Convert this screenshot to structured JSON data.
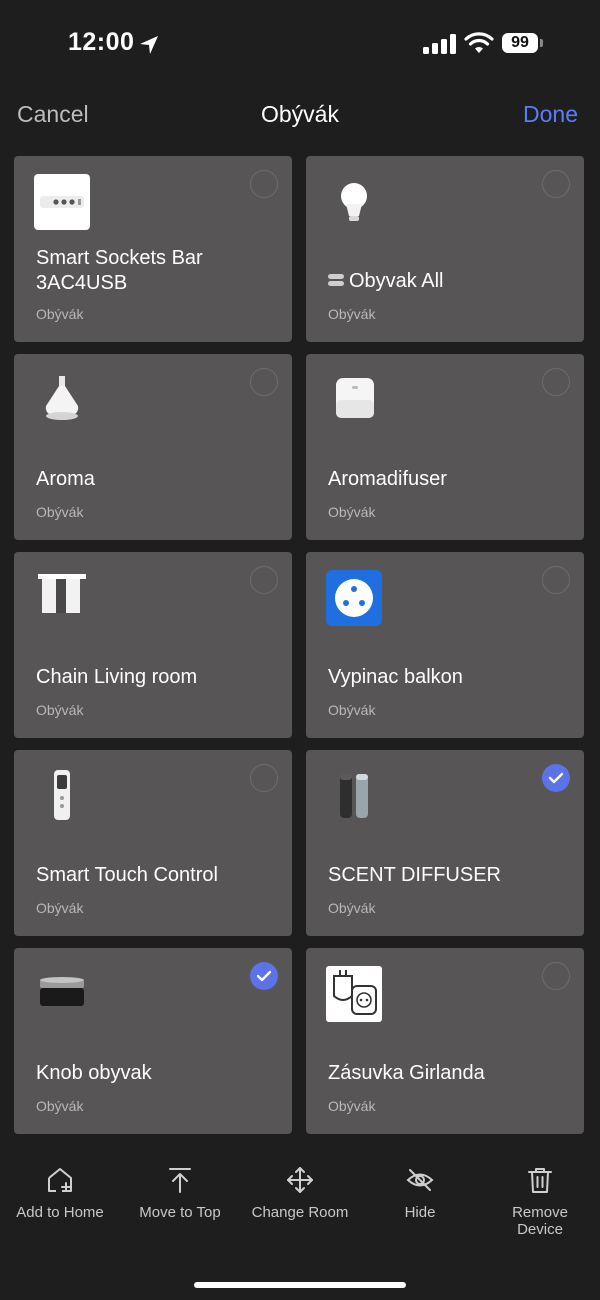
{
  "status_bar": {
    "time": "12:00",
    "battery": "99"
  },
  "nav": {
    "cancel_label": "Cancel",
    "title": "Obývák",
    "done_label": "Done"
  },
  "devices": [
    {
      "name": "Smart Sockets Bar 3AC4USB",
      "room": "Obývák",
      "icon": "power-strip-icon",
      "selected": false
    },
    {
      "name": "Obyvak All",
      "room": "Obývák",
      "icon": "light-bulb-icon",
      "selected": false
    },
    {
      "name": "Aroma",
      "room": "Obývák",
      "icon": "aroma-diffuser-icon",
      "selected": false
    },
    {
      "name": "Aromadifuser",
      "room": "Obývák",
      "icon": "diffuser-box-icon",
      "selected": false
    },
    {
      "name": "Chain Living room",
      "room": "Obývák",
      "icon": "curtain-icon",
      "selected": false
    },
    {
      "name": "Vypinac balkon",
      "room": "Obývák",
      "icon": "socket-icon",
      "selected": false
    },
    {
      "name": "Smart Touch Control",
      "room": "Obývák",
      "icon": "remote-control-icon",
      "selected": false
    },
    {
      "name": "SCENT DIFFUSER",
      "room": "Obývák",
      "icon": "scent-diffuser-icon",
      "selected": true
    },
    {
      "name": "Knob obyvak",
      "room": "Obývák",
      "icon": "knob-icon",
      "selected": true
    },
    {
      "name": "Zásuvka Girlanda",
      "room": "Obývák",
      "icon": "plug-adapter-icon",
      "selected": false
    }
  ],
  "toolbar": {
    "add_to_home": "Add to Home",
    "move_to_top": "Move to Top",
    "change_room": "Change Room",
    "hide": "Hide",
    "remove_device": "Remove Device"
  },
  "colors": {
    "accent": "#5b7cf7",
    "card": "#575555",
    "background": "#1e1e1e"
  }
}
